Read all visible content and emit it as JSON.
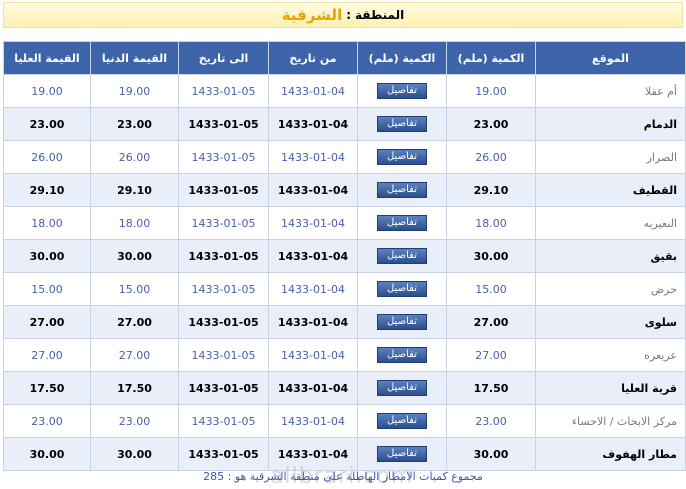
{
  "region": {
    "label": "المنطقة",
    "separator": ":",
    "value": "الشرقية"
  },
  "table": {
    "headers": [
      "الموقع",
      "الكمية (ملم)",
      "الكمية (ملم)",
      "من تاريخ",
      "الى تاريخ",
      "القيمة الدنيا",
      "القيمة العليا"
    ],
    "details_label": "تفاصيل",
    "rows": [
      {
        "site": "أم عقلا",
        "amount": "19.00",
        "from": "1433-01-04",
        "to": "1433-01-05",
        "min": "19.00",
        "max": "19.00"
      },
      {
        "site": "الدمام",
        "amount": "23.00",
        "from": "1433-01-04",
        "to": "1433-01-05",
        "min": "23.00",
        "max": "23.00"
      },
      {
        "site": "الصرار",
        "amount": "26.00",
        "from": "1433-01-04",
        "to": "1433-01-05",
        "min": "26.00",
        "max": "26.00"
      },
      {
        "site": "القطيف",
        "amount": "29.10",
        "from": "1433-01-04",
        "to": "1433-01-05",
        "min": "29.10",
        "max": "29.10"
      },
      {
        "site": "النعيريه",
        "amount": "18.00",
        "from": "1433-01-04",
        "to": "1433-01-05",
        "min": "18.00",
        "max": "18.00"
      },
      {
        "site": "بقيق",
        "amount": "30.00",
        "from": "1433-01-04",
        "to": "1433-01-05",
        "min": "30.00",
        "max": "30.00"
      },
      {
        "site": "حرض",
        "amount": "15.00",
        "from": "1433-01-04",
        "to": "1433-01-05",
        "min": "15.00",
        "max": "15.00"
      },
      {
        "site": "سلوى",
        "amount": "27.00",
        "from": "1433-01-04",
        "to": "1433-01-05",
        "min": "27.00",
        "max": "27.00"
      },
      {
        "site": "عريعره",
        "amount": "27.00",
        "from": "1433-01-04",
        "to": "1433-01-05",
        "min": "27.00",
        "max": "27.00"
      },
      {
        "site": "قرية العليا",
        "amount": "17.50",
        "from": "1433-01-04",
        "to": "1433-01-05",
        "min": "17.50",
        "max": "17.50"
      },
      {
        "site": "مركز الابحاث / الاحساء",
        "amount": "23.00",
        "from": "1433-01-04",
        "to": "1433-01-05",
        "min": "23.00",
        "max": "23.00"
      },
      {
        "site": "مطار الهفوف",
        "amount": "30.00",
        "from": "1433-01-04",
        "to": "1433-01-05",
        "min": "30.00",
        "max": "30.00"
      }
    ]
  },
  "footer": {
    "text": "مجموع كميات الامطار الهاطلة على منطقة الشرقية هو : 285"
  },
  "watermark": "allbrari.com",
  "colors": {
    "header_bg": "#3d63a8",
    "accent": "#e8a300",
    "even_row": "#e9eef9"
  }
}
